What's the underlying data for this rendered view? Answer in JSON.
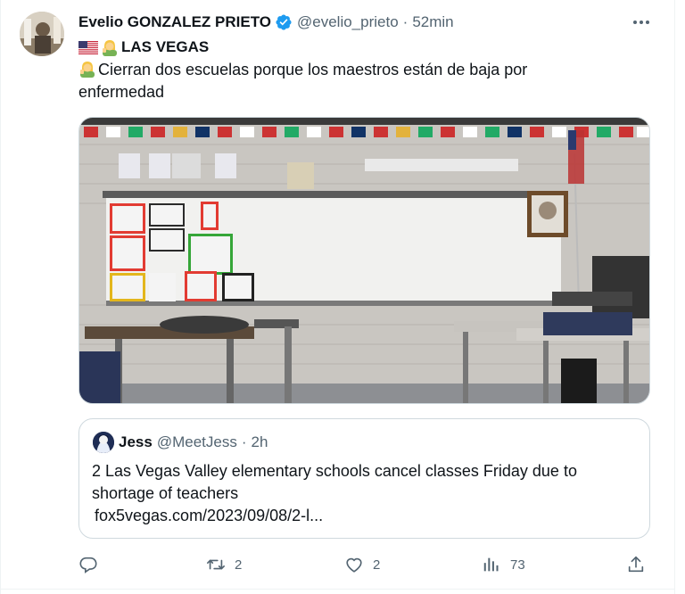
{
  "author": {
    "name": "Evelio GONZALEZ PRIETO",
    "handle": "@evelio_prieto",
    "separator": "·",
    "time": "52min"
  },
  "tweet": {
    "headline": "LAS VEGAS",
    "body": "Cierran dos escuelas porque los maestros están de baja  por enfermedad"
  },
  "quote": {
    "name": "Jess",
    "handle": "@MeetJess",
    "separator": "·",
    "time": "2h",
    "text": "2 Las Vegas Valley elementary schools cancel classes Friday due to shortage of teachers",
    "link": "fox5vegas.com/2023/09/08/2-l..."
  },
  "actions": {
    "reply_count": "",
    "retweet_count": "2",
    "like_count": "2",
    "views_count": "73"
  },
  "icons": [
    "verified-badge-icon",
    "more-options-icon",
    "us-flag-icon",
    "woman-emoji-icon",
    "reply-icon",
    "retweet-icon",
    "like-icon",
    "views-icon",
    "share-icon"
  ],
  "colors": {
    "verified": "#1d9bf0",
    "secondary_text": "#536471",
    "border": "#cfd9de"
  }
}
